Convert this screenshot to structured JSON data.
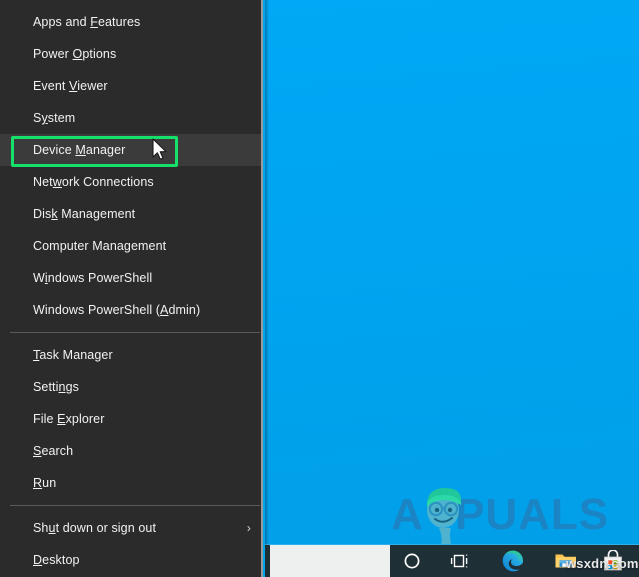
{
  "desktop": {
    "background_color": "#00a6f0"
  },
  "winx_menu": {
    "background_color": "#2b2b2b",
    "hover_color": "#3b3b3b",
    "groups": [
      {
        "items": [
          {
            "label": "Apps and Features",
            "accel": "F",
            "hovered": false,
            "submenu": false
          },
          {
            "label": "Power Options",
            "accel": "O",
            "hovered": false,
            "submenu": false
          },
          {
            "label": "Event Viewer",
            "accel": "V",
            "hovered": false,
            "submenu": false
          },
          {
            "label": "System",
            "accel": "y",
            "hovered": false,
            "submenu": false
          },
          {
            "label": "Device Manager",
            "accel": "M",
            "hovered": true,
            "submenu": false
          },
          {
            "label": "Network Connections",
            "accel": "w",
            "hovered": false,
            "submenu": false
          },
          {
            "label": "Disk Management",
            "accel": "k",
            "hovered": false,
            "submenu": false
          },
          {
            "label": "Computer Management",
            "accel": "G",
            "hovered": false,
            "submenu": false
          },
          {
            "label": "Windows PowerShell",
            "accel": "i",
            "hovered": false,
            "submenu": false
          },
          {
            "label": "Windows PowerShell (Admin)",
            "accel": "A",
            "hovered": false,
            "submenu": false
          }
        ]
      },
      {
        "items": [
          {
            "label": "Task Manager",
            "accel": "T",
            "hovered": false,
            "submenu": false
          },
          {
            "label": "Settings",
            "accel": "n",
            "hovered": false,
            "submenu": false
          },
          {
            "label": "File Explorer",
            "accel": "E",
            "hovered": false,
            "submenu": false
          },
          {
            "label": "Search",
            "accel": "S",
            "hovered": false,
            "submenu": false
          },
          {
            "label": "Run",
            "accel": "R",
            "hovered": false,
            "submenu": false
          }
        ]
      },
      {
        "items": [
          {
            "label": "Shut down or sign out",
            "accel": "u",
            "hovered": false,
            "submenu": true
          },
          {
            "label": "Desktop",
            "accel": "D",
            "hovered": false,
            "submenu": false
          }
        ]
      }
    ]
  },
  "annotation": {
    "highlight_color": "#15e06a",
    "highlight_target": "Device Manager",
    "cursor": "arrow-pointer"
  },
  "taskbar": {
    "background_color": "#1f2f36",
    "search_box": {
      "value": "",
      "placeholder": ""
    },
    "icons": [
      {
        "name": "cortana-icon",
        "label": "Cortana"
      },
      {
        "name": "task-view-icon",
        "label": "Task View"
      },
      {
        "name": "microsoft-edge-icon",
        "label": "Microsoft Edge"
      },
      {
        "name": "file-explorer-icon",
        "label": "File Explorer"
      },
      {
        "name": "microsoft-store-icon",
        "label": "Microsoft Store"
      }
    ]
  },
  "watermarks": {
    "logo_text": "APPUALS",
    "site_text": "wsxdn.com"
  }
}
